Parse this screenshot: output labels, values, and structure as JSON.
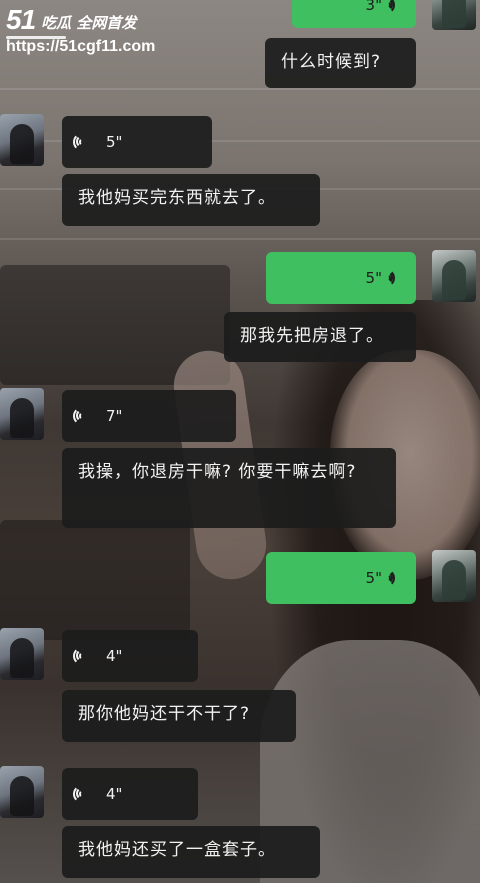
{
  "watermark": {
    "logo_num": "51",
    "logo_text": "吃瓜 全网首发",
    "url": "https://51cgf11.com"
  },
  "messages": [
    {
      "side": "right",
      "kind": "voice",
      "duration": "3\""
    },
    {
      "side": "right",
      "kind": "text",
      "text": "什么时候到?"
    },
    {
      "side": "left",
      "kind": "voice",
      "duration": "5\""
    },
    {
      "side": "left",
      "kind": "text",
      "text": "我他妈买完东西就去了。"
    },
    {
      "side": "right",
      "kind": "voice",
      "duration": "5\""
    },
    {
      "side": "right",
      "kind": "text",
      "text": "那我先把房退了。"
    },
    {
      "side": "left",
      "kind": "voice",
      "duration": "7\""
    },
    {
      "side": "left",
      "kind": "text",
      "text": "我操，你退房干嘛? 你要干嘛去啊?"
    },
    {
      "side": "right",
      "kind": "voice",
      "duration": "5\""
    },
    {
      "side": "left",
      "kind": "voice",
      "duration": "4\""
    },
    {
      "side": "left",
      "kind": "text",
      "text": "那你他妈还干不干了?"
    },
    {
      "side": "left",
      "kind": "voice",
      "duration": "4\""
    },
    {
      "side": "left",
      "kind": "text",
      "text": "我他妈还买了一盒套子。"
    }
  ],
  "colors": {
    "green_bubble": "#3fbf60",
    "dark_bubble": "#1c1c1c"
  }
}
